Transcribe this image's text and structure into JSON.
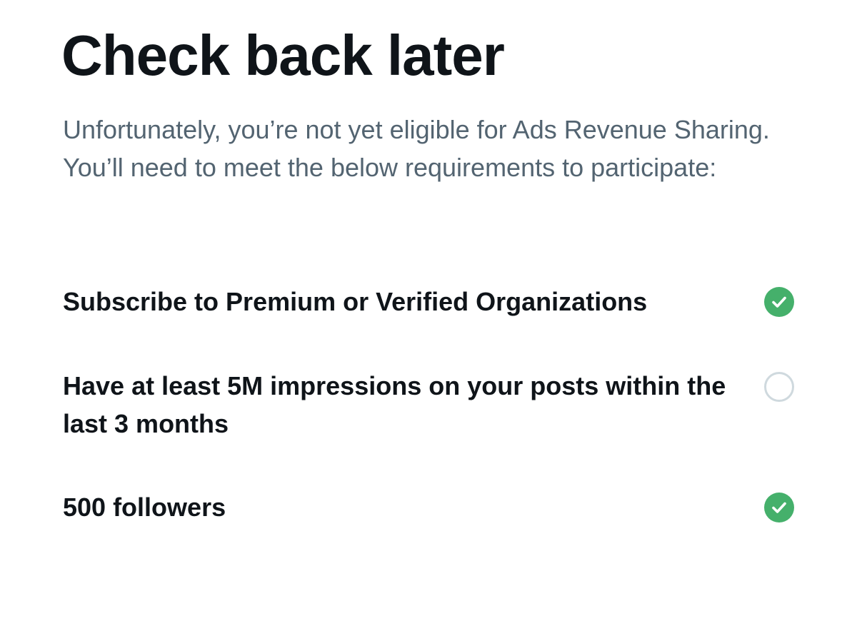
{
  "header": {
    "title": "Check back later",
    "description": "Unfortunately, you’re not yet eligible for Ads Revenue Sharing. You’ll need to meet the below requirements to participate:"
  },
  "requirements": [
    {
      "label": "Subscribe to Premium or Verified Organizations",
      "met": true,
      "icon": "check-circle-icon"
    },
    {
      "label": "Have at least 5M impressions on your posts within the last 3 months",
      "met": false,
      "icon": "empty-circle-icon"
    },
    {
      "label": "500 followers",
      "met": true,
      "icon": "check-circle-icon"
    }
  ],
  "colors": {
    "met": "#45b06b",
    "unmet_outline": "#cfd9de",
    "title_text": "#0f1419",
    "secondary_text": "#536471"
  }
}
